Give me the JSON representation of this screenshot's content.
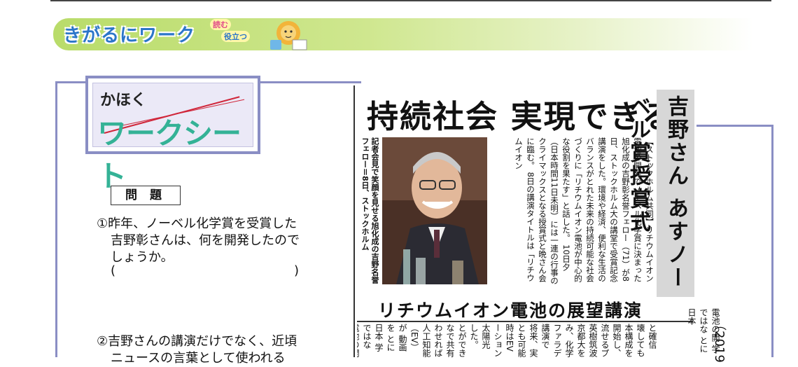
{
  "banner": {
    "title": "きがるにワーク",
    "tag_read": "読む",
    "tag_use": "役立つ"
  },
  "worksheet": {
    "small": "かほく",
    "big": "ワークシート"
  },
  "questions": {
    "header": "問 題",
    "q1_line1": "①昨年、ノーベル化学賞を受賞した",
    "q1_line2": "吉野彰さんは、何を開発したので",
    "q1_line3": "しょうか。",
    "blank_open": "(",
    "blank_close": ")",
    "q2_line1": "②吉野さんの講演だけでなく、近頃",
    "q2_line2": "ニュースの言葉として使われる"
  },
  "article": {
    "headline": "持続社会 実現できる",
    "vertical_headline": "吉野さん あすノーベル賞授賞式",
    "caption": "記者会見で笑顔を見せる旭化成の吉野名誉フェロー＝8日、ストックホルム",
    "body": "【ストックホルム共同】リチウムイオン電池の開発でノーベル化学賞に決まった旭化成の吉野彰名誉フェロー（71）が8日、ストックホルム大の講堂で受賞記念講演をした。環境や経済、便利な生活のバランスがとれた未来の持続可能な社会づくりに「リチウムイオン電池が中心的な役割を果たす」と話した。 10日夕（日本時間11日未明）には一連の行事のクライマックスとなる授賞式と晩さん会に臨む。 8日の講演タイトルは「リチウムイオン",
    "subhead": "リチウムイオン電池の展望講演",
    "body2": "と確信 壊しても 本構成を 開始し、 流せるプ 英樹筑波 京都大を み、化学 ファラデ 講演で 将来、実 とも可能 時はEV ーション 太陽光 した。 とができ なで共有 わせれば 人工知能 （EV）が 動画を とに日本 学ではな 電池の開",
    "body3": "電池の開 学ではな とに日本",
    "year": "（2019"
  }
}
